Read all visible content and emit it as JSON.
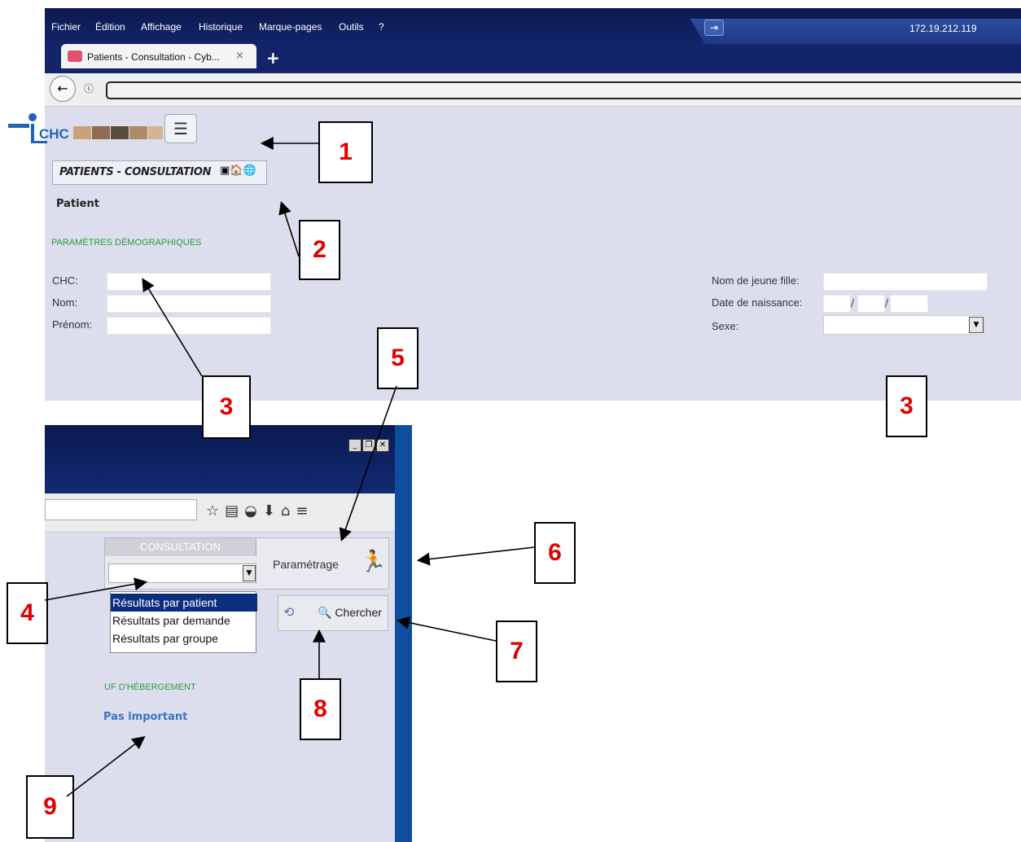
{
  "browser": {
    "menus": [
      "Fichier",
      "Édition",
      "Affichage",
      "Historique",
      "Marque-pages",
      "Outils",
      "?"
    ],
    "ip_address": "172.19.212.119",
    "tab_title": "Patients - Consultation - Cyb...",
    "tab_close": "×",
    "new_tab": "+"
  },
  "page": {
    "logo_text": "CHC",
    "banner_title": "PATIENTS - CONSULTATION",
    "patient_heading": "Patient",
    "section_demographics": "PARAMÈTRES DÉMOGRAPHIQUES",
    "fields_left": [
      "CHC:",
      "Nom:",
      "Prénom:"
    ],
    "fields_right": [
      "Nom de jeune fille:",
      "Date de naissance:",
      "Sexe:"
    ],
    "date_separator": "/"
  },
  "panel": {
    "consultation_header": "CONSULTATION",
    "parametrage": "Paramétrage",
    "dropdown_options": [
      "Résultats par patient",
      "Résultats par demande",
      "Résultats par groupe"
    ],
    "selected_option_index": 0,
    "search_button": "Chercher",
    "uf_heading": "UF D'HÉBERGEMENT",
    "uf_value": "Pas important"
  },
  "callouts": [
    "1",
    "2",
    "3",
    "3",
    "5",
    "6",
    "4",
    "7",
    "8",
    "9"
  ]
}
